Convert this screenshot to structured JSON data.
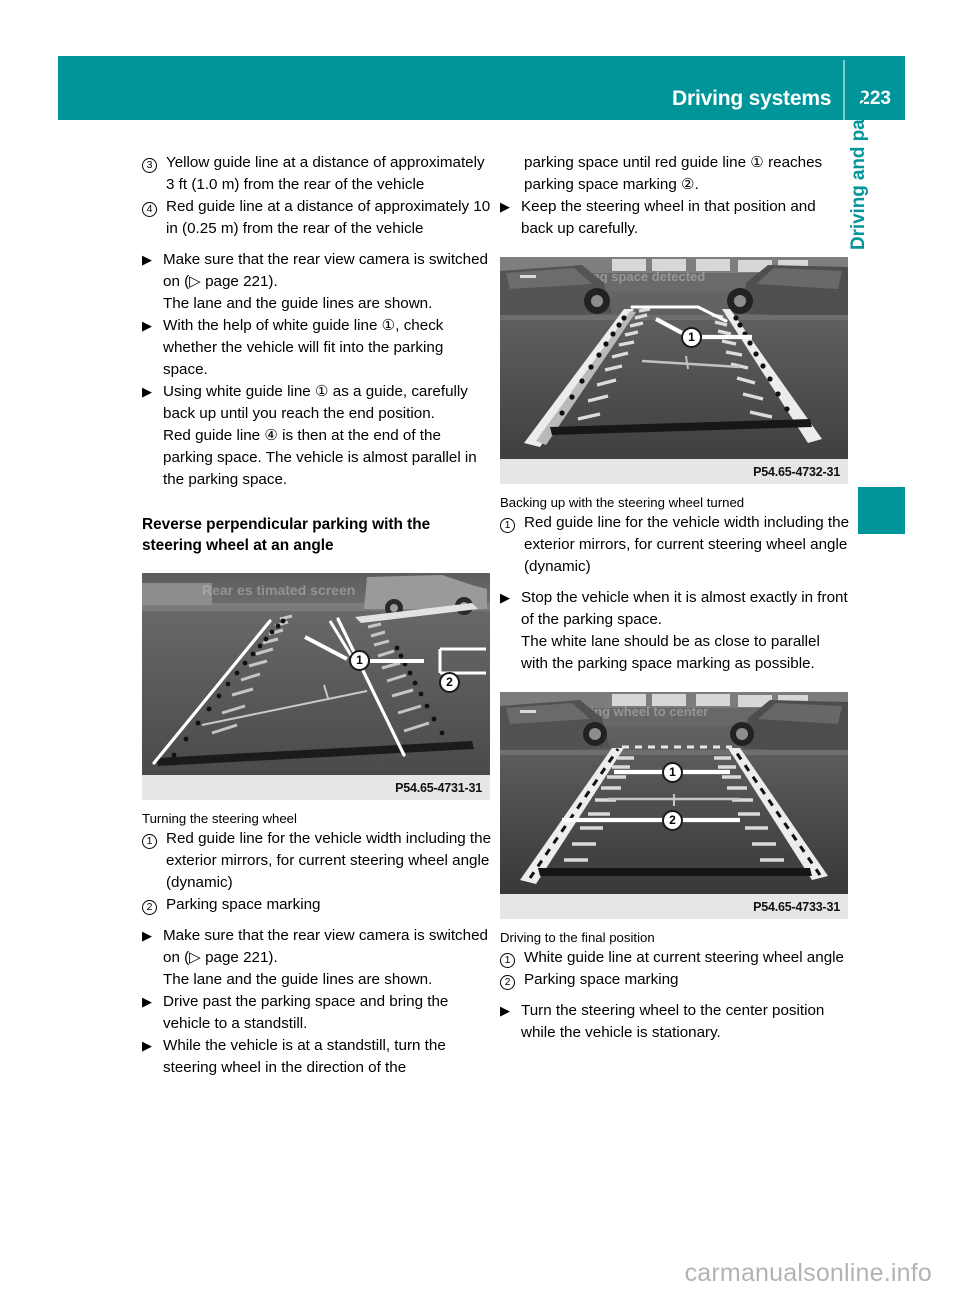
{
  "header": {
    "title": "Driving systems",
    "page_number": "223",
    "accent_color": "#009599"
  },
  "side_tab": {
    "label": "Driving and parking"
  },
  "left_column": {
    "legend_top": [
      {
        "num": "3",
        "text": "Yellow guide line at a distance of approximately 3 ft (1.0 m) from the rear of the vehicle"
      },
      {
        "num": "4",
        "text": "Red guide line at a distance of approximately 10 in (0.25 m) from the rear of the vehicle"
      }
    ],
    "steps_top": [
      {
        "lines": [
          "Make sure that the rear view camera is switched on (▷ page 221).",
          "The lane and the guide lines are shown."
        ]
      },
      {
        "lines": [
          "With the help of white guide line ①, check whether the vehicle will fit into the parking space."
        ]
      },
      {
        "lines": [
          "Using white guide line ① as a guide, carefully back up until you reach the end position.",
          "Red guide line ④ is then at the end of the parking space. The vehicle is almost parallel in the parking space."
        ]
      }
    ],
    "heading": "Reverse perpendicular parking with the steering wheel at an angle",
    "figure": {
      "code": "P54.65-4731-31",
      "caption": "Turning the steering wheel",
      "callouts": [
        "1",
        "2"
      ]
    },
    "legend_fig": [
      {
        "num": "1",
        "text": "Red guide line for the vehicle width including the exterior mirrors, for current steering wheel angle (dynamic)"
      },
      {
        "num": "2",
        "text": "Parking space marking"
      }
    ],
    "steps_bottom": [
      {
        "lines": [
          "Make sure that the rear view camera is switched on (▷ page 221).",
          "The lane and the guide lines are shown."
        ]
      },
      {
        "lines": [
          "Drive past the parking space and bring the vehicle to a standstill."
        ]
      },
      {
        "lines": [
          "While the vehicle is at a standstill, turn the steering wheel in the direction of the"
        ]
      }
    ]
  },
  "right_column": {
    "continuation": "parking space until red guide line ① reaches parking space marking ②.",
    "steps_top": [
      {
        "lines": [
          "Keep the steering wheel in that position and back up carefully."
        ]
      }
    ],
    "figure_1": {
      "code": "P54.65-4732-31",
      "caption": "Backing up with the steering wheel turned",
      "callouts": [
        "1"
      ]
    },
    "legend_1": [
      {
        "num": "1",
        "text": "Red guide line for the vehicle width including the exterior mirrors, for current steering wheel angle (dynamic)"
      }
    ],
    "steps_mid": [
      {
        "lines": [
          "Stop the vehicle when it is almost exactly in front of the parking space.",
          "The white lane should be as close to parallel with the parking space marking as possible."
        ]
      }
    ],
    "figure_2": {
      "code": "P54.65-4733-31",
      "caption": "Driving to the final position",
      "callouts": [
        "1",
        "2"
      ]
    },
    "legend_2": [
      {
        "num": "1",
        "text": "White guide line at current steering wheel angle"
      },
      {
        "num": "2",
        "text": "Parking space marking"
      }
    ],
    "steps_bottom": [
      {
        "lines": [
          "Turn the steering wheel to the center position while the vehicle is stationary."
        ]
      }
    ]
  },
  "watermark": "carmanualsonline.info"
}
